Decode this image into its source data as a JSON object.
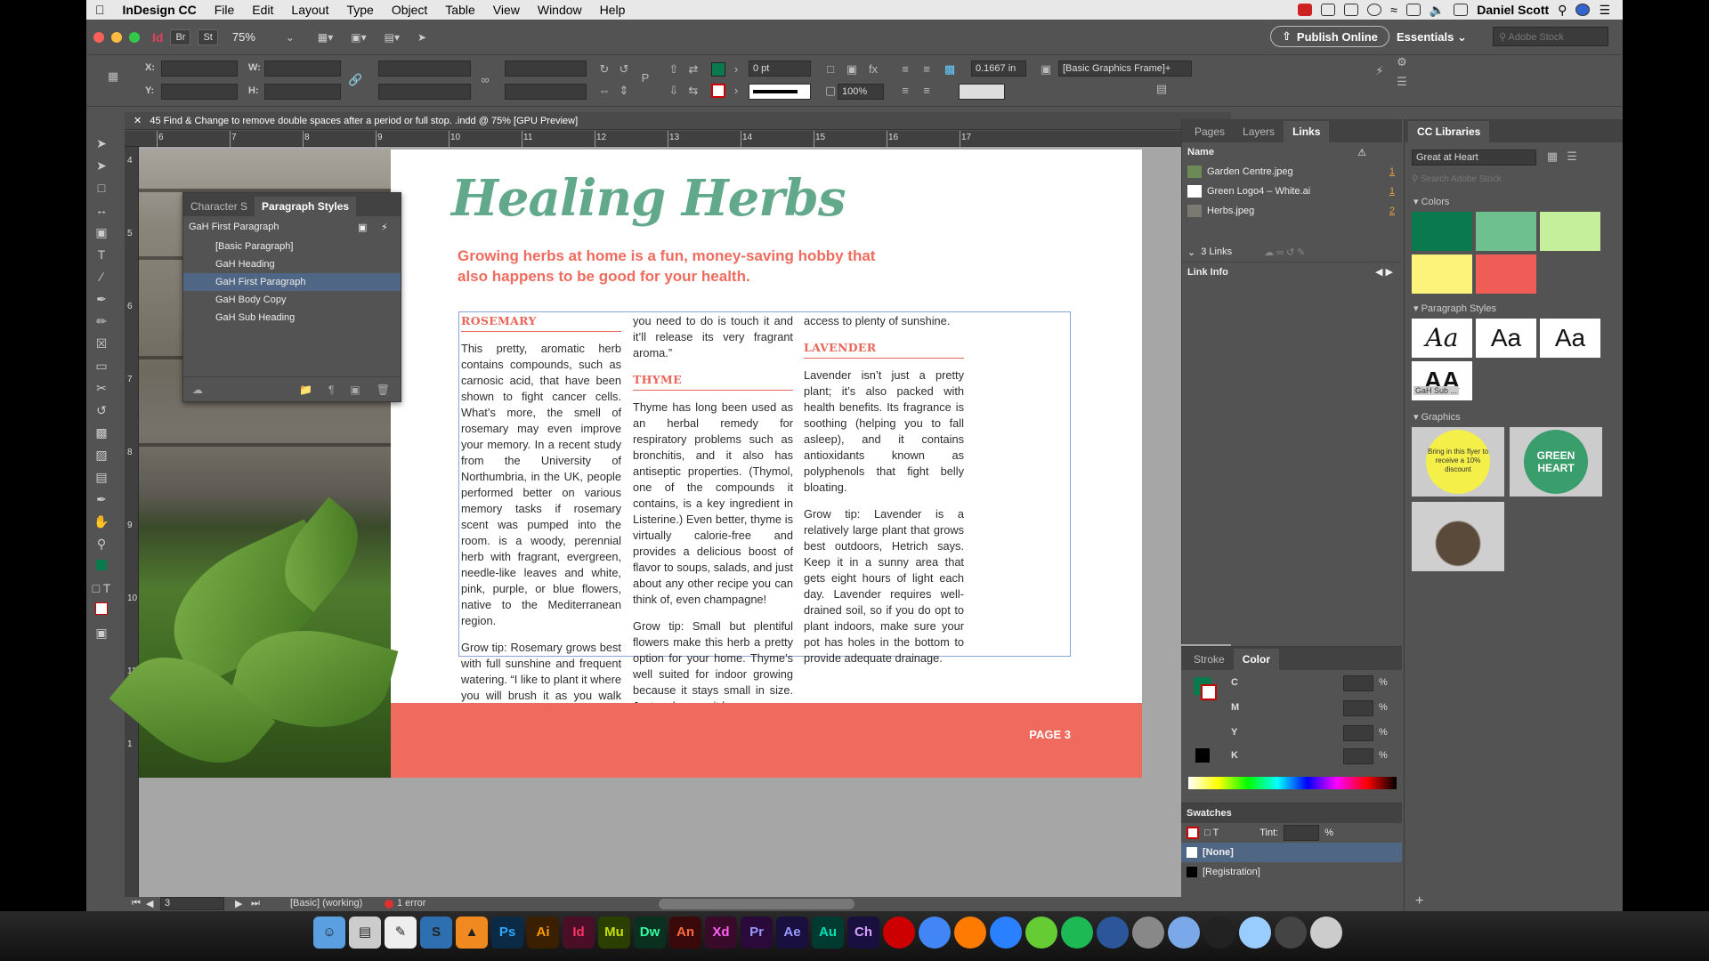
{
  "menubar": {
    "app_name": "InDesign CC",
    "items": [
      "File",
      "Edit",
      "Layout",
      "Type",
      "Object",
      "Table",
      "View",
      "Window",
      "Help"
    ],
    "user": "Daniel Scott"
  },
  "appbar": {
    "br": "Br",
    "st": "St",
    "zoom": "75%",
    "publish": "Publish Online",
    "workspace": "Essentials",
    "search_placeholder": "Adobe Stock"
  },
  "control": {
    "x_label": "X:",
    "y_label": "Y:",
    "w_label": "W:",
    "h_label": "H:",
    "stroke_weight": "0 pt",
    "opacity": "100%",
    "offset": "0.1667 in",
    "object_style": "[Basic Graphics Frame]+"
  },
  "doctab": {
    "label": "45 Find & Change to remove double spaces after a period or full stop. .indd @ 75% [GPU Preview]"
  },
  "ruler": {
    "top": [
      "6",
      "7",
      "8",
      "9",
      "10",
      "11",
      "12",
      "13",
      "14",
      "15",
      "16",
      "17"
    ],
    "left": [
      "4",
      "5",
      "6",
      "7",
      "8",
      "9",
      "10",
      "11",
      "1"
    ]
  },
  "page": {
    "title": "Healing Herbs",
    "subtitle": "Growing herbs at home is a fun, money-saving hobby that also happens to be good for your health.",
    "footer": "PAGE 3",
    "col1": {
      "heading": "ROSEMARY",
      "p1": "This pretty, aromatic herb contains compounds, such as carnosic acid, that have been shown to fight cancer cells. What’s more, the smell of rosemary may even improve your memory. In a recent study from the University of Northumbria, in the UK, people performed better on various memory tasks if rosemary scent was pumped into the room. is a woody, perennial herb with fragrant, evergreen, needle-like leaves and white, pink, purple, or blue flowers, native to the Mediterranean region.",
      "p2": "Grow tip: Rosemary grows best with full sunshine and frequent watering. “I like to plant it where you will brush it as you walk by,” Hetrich says. “All"
    },
    "col2": {
      "p0": "you need to do is touch it and it’ll release its very fragrant aroma.”",
      "heading": "THYME",
      "p1": "Thyme has long been used as an herbal remedy for respiratory problems such as bronchitis, and it also has antiseptic properties.  (Thymol, one of the compounds it contains, is a key ingredient in Listerine.) Even better, thyme is virtually calorie-free and provides a delicious boost of flavor to soups, salads, and just about any other recipe you can think of, even champagne!",
      "p2": "Grow tip: Small but plentiful flowers make this herb a pretty option for your home.  Thyme’s well suited for indoor growing because it stays small in size.  Just make sure it has"
    },
    "col3": {
      "p0": "access to plenty of sunshine.",
      "heading": "LAVENDER",
      "p1": "Lavender isn’t just a pretty plant; it’s also packed with health benefits. Its fragrance is soothing (helping you to fall asleep), and it contains antioxidants known as polyphenols that fight belly bloating.",
      "p2": "Grow tip: Lavender is a relatively large plant that grows best outdoors, Hetrich says.  Keep it in a sunny area that gets eight hours of light each day.  Lavender requires well-drained soil, so if you do opt to plant indoors, make sure your pot has holes in the bottom to provide adequate drainage."
    }
  },
  "pstyles_panel": {
    "tab1": "Character S",
    "tab2": "Paragraph Styles",
    "current": "GaH First Paragraph",
    "items": [
      "[Basic Paragraph]",
      "GaH Heading",
      "GaH First Paragraph",
      "GaH Body Copy",
      "GaH Sub Heading"
    ]
  },
  "links_panel": {
    "tabs": [
      "Pages",
      "Layers",
      "Links"
    ],
    "header_name": "Name",
    "rows": [
      {
        "name": "Garden Centre.jpeg",
        "count": "1"
      },
      {
        "name": "Green Logo4 – White.ai",
        "count": "1"
      },
      {
        "name": "Herbs.jpeg",
        "count": "2"
      }
    ],
    "links_count": "3 Links",
    "link_info": "Link Info"
  },
  "color_panel": {
    "tab1": "Stroke",
    "tab2": "Color",
    "c": "C",
    "m": "M",
    "y": "Y",
    "k": "K",
    "pct": "%"
  },
  "swatches_panel": {
    "title": "Swatches",
    "tint_label": "Tint:",
    "pct": "%",
    "none": "[None]",
    "registration": "[Registration]"
  },
  "cclib": {
    "title": "CC Libraries",
    "library": "Great at Heart",
    "search": "Search Adobe Stock",
    "colors_label": "Colors",
    "pstyles_label": "Paragraph Styles",
    "pstyle_caption": "GaH Sub ...",
    "graphics_label": "Graphics",
    "badge_text": "Bring in this flyer to receive a 10% discount",
    "logo_text": "GREEN HEART",
    "swatch_colors": [
      "#0a7a4e",
      "#6ec18f",
      "#c6ef9c",
      "#fdf27a",
      "#f05d57"
    ]
  },
  "status": {
    "page": "3",
    "preflight_profile": "[Basic] (working)",
    "errors": "1 error"
  },
  "dock": [
    "Ps",
    "Ai",
    "Id",
    "Mu",
    "Dw",
    "An",
    "Xd",
    "Pr",
    "Ae",
    "Au",
    "Ch"
  ]
}
